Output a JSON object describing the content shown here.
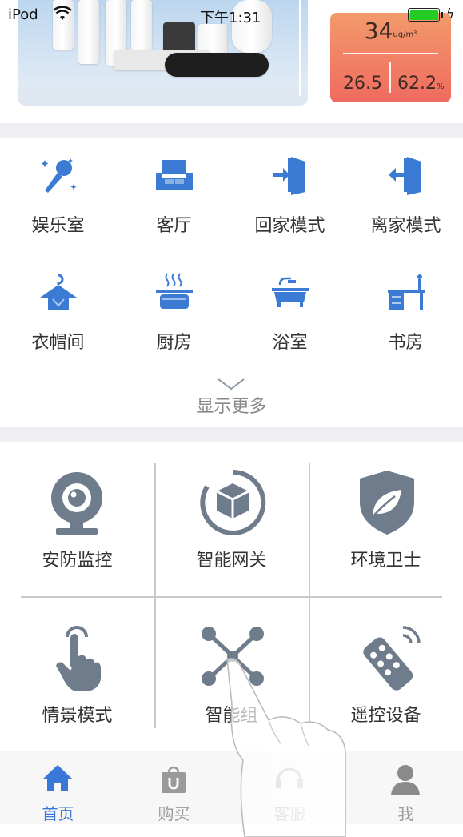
{
  "status_bar": {
    "carrier": "iPod",
    "time": "下午1:31"
  },
  "env_card": {
    "pm25": "34",
    "pm25_unit": "ug/m³",
    "temperature": "26.5",
    "humidity": "62.2",
    "humidity_unit": "%"
  },
  "rooms": [
    {
      "label": "娱乐室",
      "icon": "microphone-icon"
    },
    {
      "label": "客厅",
      "icon": "sofa-icon"
    },
    {
      "label": "回家模式",
      "icon": "door-enter-icon"
    },
    {
      "label": "离家模式",
      "icon": "door-exit-icon"
    },
    {
      "label": "衣帽间",
      "icon": "hanger-icon"
    },
    {
      "label": "厨房",
      "icon": "cooking-pot-icon"
    },
    {
      "label": "浴室",
      "icon": "bathtub-icon"
    },
    {
      "label": "书房",
      "icon": "desk-icon"
    }
  ],
  "show_more": {
    "label": "显示更多"
  },
  "features": [
    {
      "label": "安防监控",
      "icon": "webcam-icon"
    },
    {
      "label": "智能网关",
      "icon": "gateway-cube-icon"
    },
    {
      "label": "环境卫士",
      "icon": "leaf-shield-icon"
    },
    {
      "label": "情景模式",
      "icon": "tap-hand-icon"
    },
    {
      "label": "智能组",
      "icon": "network-nodes-icon"
    },
    {
      "label": "遥控设备",
      "icon": "remote-control-icon"
    }
  ],
  "tabs": [
    {
      "label": "首页",
      "icon": "home-icon",
      "active": true
    },
    {
      "label": "购买",
      "icon": "shopping-bag-icon",
      "active": false
    },
    {
      "label": "客服",
      "icon": "customer-service-icon",
      "active": false
    },
    {
      "label": "我",
      "icon": "person-icon",
      "active": false
    }
  ],
  "colors": {
    "accent": "#3a78d8",
    "icon_blue": "#3b7bd4",
    "icon_gray": "#6f7c8c",
    "card_top": "#f39a6b",
    "card_bottom": "#f06a60"
  }
}
